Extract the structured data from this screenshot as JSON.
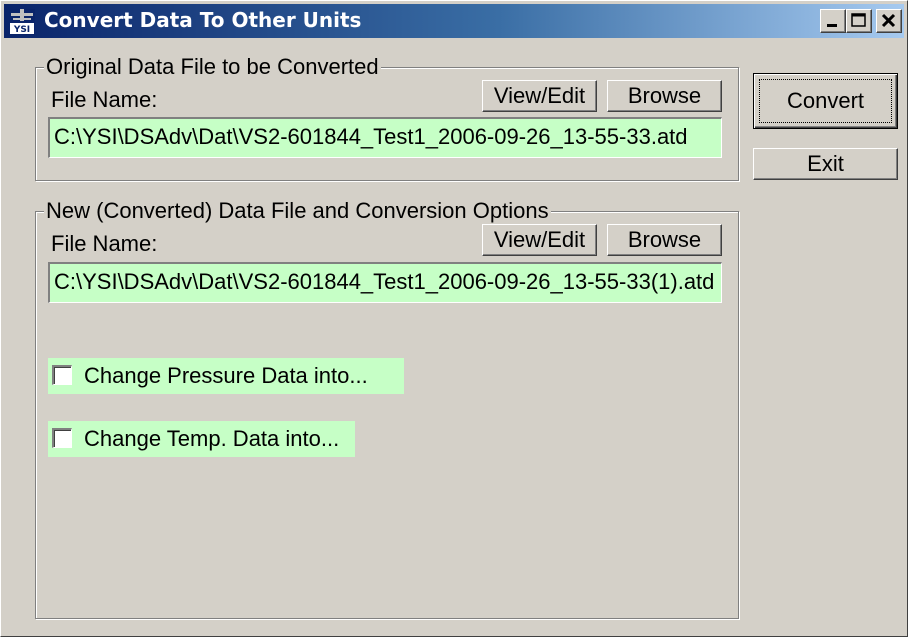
{
  "window": {
    "title": "Convert Data To Other Units",
    "icon_text": "YSI",
    "controls": {
      "minimize": "_",
      "maximize": "□",
      "close": "×"
    }
  },
  "original_group": {
    "label": "Original Data File to be Converted",
    "file_name_label": "File Name:",
    "view_edit": "View/Edit",
    "browse": "Browse",
    "path": "C:\\YSI\\DSAdv\\Dat\\VS2-601844_Test1_2006-09-26_13-55-33.atd"
  },
  "new_group": {
    "label": "New (Converted) Data File and Conversion Options",
    "file_name_label": "File Name:",
    "view_edit": "View/Edit",
    "browse": "Browse",
    "path": "C:\\YSI\\DSAdv\\Dat\\VS2-601844_Test1_2006-09-26_13-55-33(1).atd",
    "options": [
      {
        "label": "Change Pressure Data into...",
        "checked": false
      },
      {
        "label": "Change Temp. Data into...",
        "checked": false
      }
    ]
  },
  "actions": {
    "convert": "Convert",
    "exit": "Exit"
  }
}
